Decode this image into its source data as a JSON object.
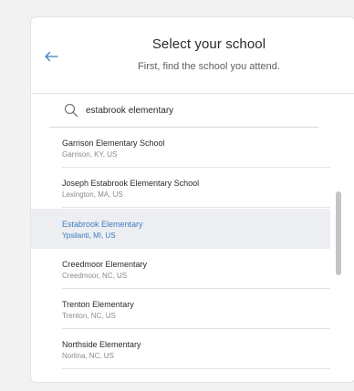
{
  "header": {
    "title": "Select your school",
    "subtitle": "First, find the school you attend."
  },
  "search": {
    "value": "estabrook elementary"
  },
  "results": [
    {
      "name": "Garrison Elementary School",
      "location": "Garrison, KY, US",
      "selected": false
    },
    {
      "name": "Joseph Estabrook Elementary School",
      "location": "Lexington, MA, US",
      "selected": false
    },
    {
      "name": "Estabrook Elementary",
      "location": "Ypsilanti, MI, US",
      "selected": true
    },
    {
      "name": "Creedmoor Elementary",
      "location": "Creedmoor, NC, US",
      "selected": false
    },
    {
      "name": "Trenton Elementary",
      "location": "Trenton, NC, US",
      "selected": false
    },
    {
      "name": "Northside Elementary",
      "location": "Norlina, NC, US",
      "selected": false
    }
  ],
  "colors": {
    "accent": "#3e7bc4",
    "selected_bg": "#eceef1"
  },
  "icons": {
    "back": "arrow-left-icon",
    "search": "search-icon"
  }
}
